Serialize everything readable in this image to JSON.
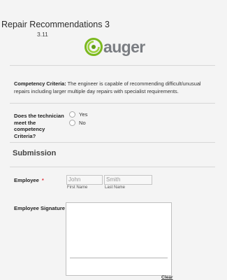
{
  "header": {
    "title": "Repair Recommendations 3",
    "version": "3.11",
    "logo_text": "auger",
    "brand_color": "#7cb91f"
  },
  "criteria": {
    "label": "Competency Criteria:",
    "text": "The engineer is capable of recommending difficult/unusual repairs including larger multiple day repairs with specialist requirements."
  },
  "question": {
    "label": "Does the technician meet the competency Criteria?",
    "options": [
      "Yes",
      "No"
    ]
  },
  "submission": {
    "title": "Submission",
    "employee": {
      "label": "Employee",
      "required_mark": "*",
      "first_value": "John",
      "first_sublabel": "First Name",
      "last_value": "Smith",
      "last_sublabel": "Last Name"
    },
    "signature": {
      "label": "Employee Signature",
      "required_mark": "*",
      "clear_label": "Clear"
    }
  }
}
